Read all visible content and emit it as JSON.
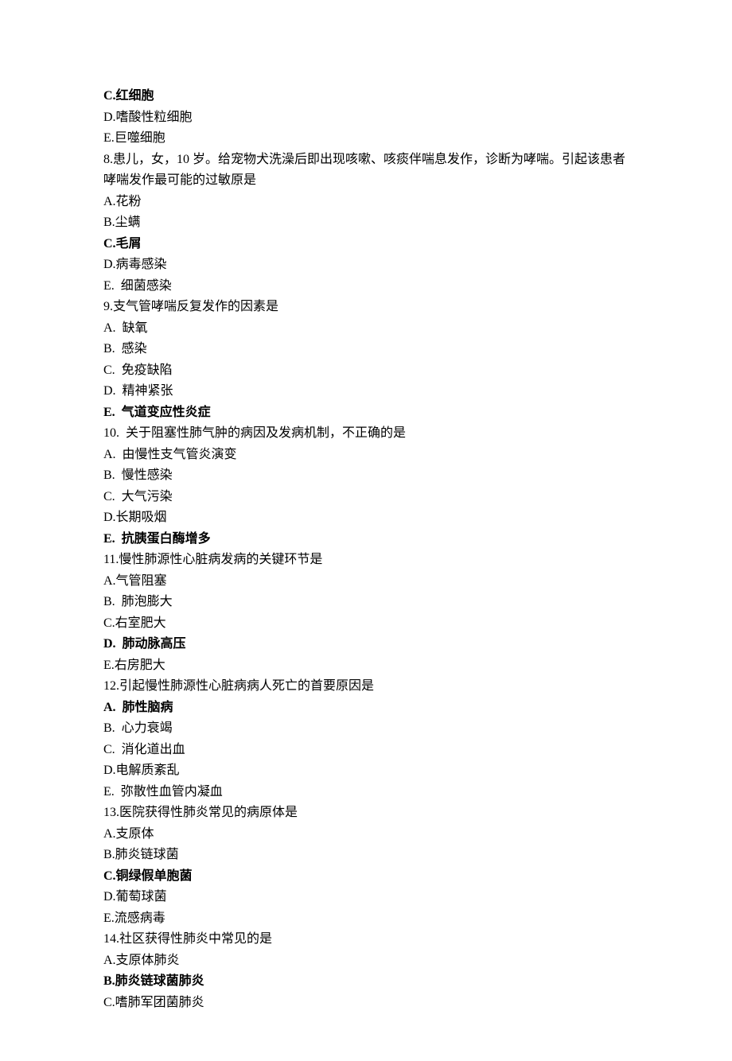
{
  "lines": [
    {
      "text": "C.红细胞",
      "bold": true
    },
    {
      "text": "D.嗜酸性粒细胞",
      "bold": false
    },
    {
      "text": "E.巨噬细胞",
      "bold": false
    },
    {
      "text": "8.患儿，女，10 岁。给宠物犬洗澡后即出现咳嗽、咳痰伴喘息发作，诊断为哮喘。引起该患者哮喘发作最可能的过敏原是",
      "bold": false
    },
    {
      "text": "A.花粉",
      "bold": false
    },
    {
      "text": "B.尘螨",
      "bold": false
    },
    {
      "text": "C.毛屑",
      "bold": true
    },
    {
      "text": "D.病毒感染",
      "bold": false
    },
    {
      "text": "E.  细菌感染",
      "bold": false
    },
    {
      "text": "9.支气管哮喘反复发作的因素是",
      "bold": false
    },
    {
      "text": "A.  缺氧",
      "bold": false
    },
    {
      "text": "B.  感染",
      "bold": false
    },
    {
      "text": "C.  免疫缺陷",
      "bold": false
    },
    {
      "text": "D.  精神紧张",
      "bold": false
    },
    {
      "text": "E.  气道变应性炎症",
      "bold": true
    },
    {
      "text": "10.  关于阻塞性肺气肿的病因及发病机制，不正确的是",
      "bold": false
    },
    {
      "text": "A.  由慢性支气管炎演变",
      "bold": false
    },
    {
      "text": "B.  慢性感染",
      "bold": false
    },
    {
      "text": "C.  大气污染",
      "bold": false
    },
    {
      "text": "D.长期吸烟",
      "bold": false
    },
    {
      "text": "E.  抗胰蛋白酶增多",
      "bold": true
    },
    {
      "text": "11.慢性肺源性心脏病发病的关键环节是",
      "bold": false
    },
    {
      "text": "A.气管阻塞",
      "bold": false
    },
    {
      "text": "B.  肺泡膨大",
      "bold": false
    },
    {
      "text": "C.右室肥大",
      "bold": false
    },
    {
      "text": "D.  肺动脉高压",
      "bold": true
    },
    {
      "text": "E.右房肥大",
      "bold": false
    },
    {
      "text": "12.引起慢性肺源性心脏病病人死亡的首要原因是",
      "bold": false
    },
    {
      "text": "A.  肺性脑病",
      "bold": true
    },
    {
      "text": "B.  心力衰竭",
      "bold": false
    },
    {
      "text": "C.  消化道出血",
      "bold": false
    },
    {
      "text": "D.电解质紊乱",
      "bold": false
    },
    {
      "text": "E.  弥散性血管内凝血",
      "bold": false
    },
    {
      "text": "13.医院获得性肺炎常见的病原体是",
      "bold": false
    },
    {
      "text": "A.支原体",
      "bold": false
    },
    {
      "text": "B.肺炎链球菌",
      "bold": false
    },
    {
      "text": "C.铜绿假单胞菌",
      "bold": true
    },
    {
      "text": "D.葡萄球菌",
      "bold": false
    },
    {
      "text": "E.流感病毒",
      "bold": false
    },
    {
      "text": "14.社区获得性肺炎中常见的是",
      "bold": false
    },
    {
      "text": "A.支原体肺炎",
      "bold": false
    },
    {
      "text": "B.肺炎链球菌肺炎",
      "bold": true
    },
    {
      "text": "C.嗜肺军团菌肺炎",
      "bold": false
    }
  ]
}
